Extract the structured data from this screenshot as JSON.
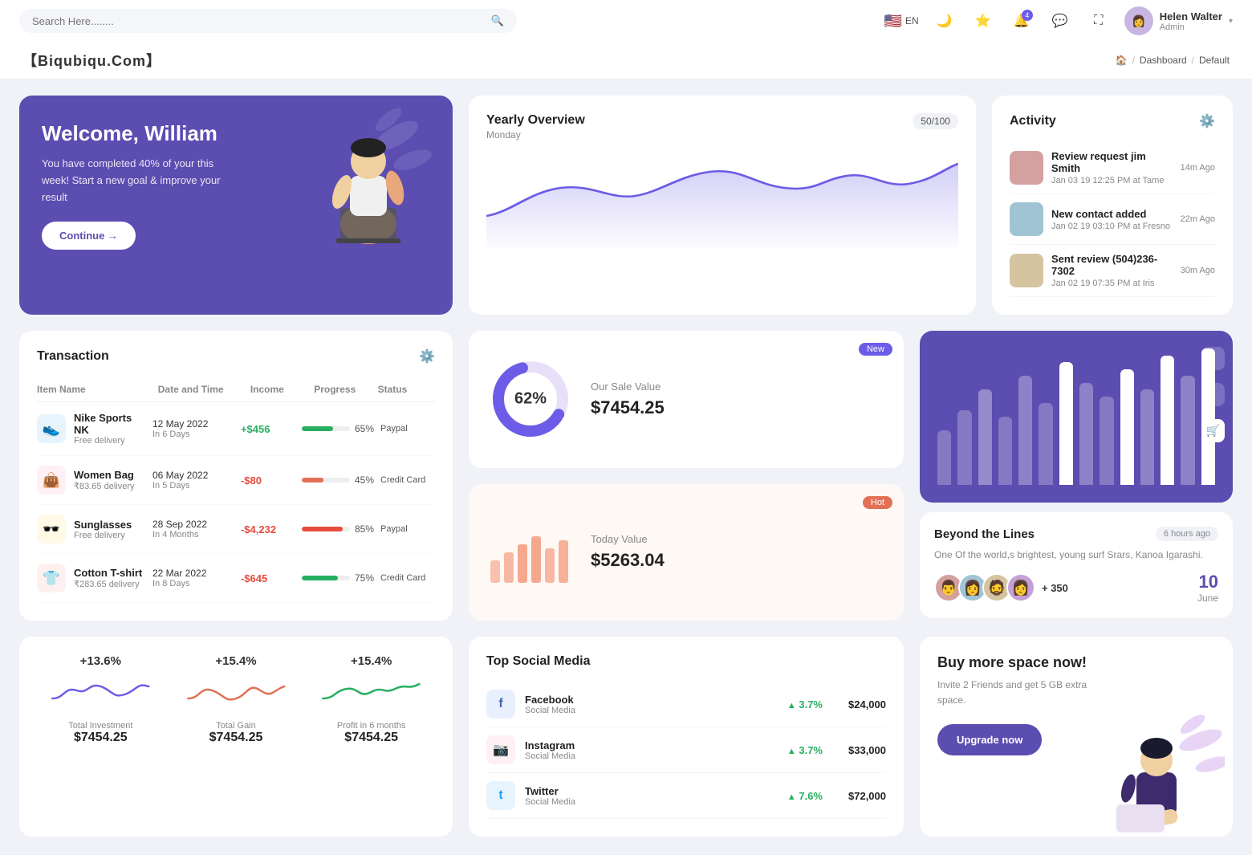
{
  "topnav": {
    "search_placeholder": "Search Here........",
    "lang": "EN",
    "user_name": "Helen Walter",
    "user_role": "Admin",
    "notification_count": "4"
  },
  "breadcrumb": {
    "brand": "【Biqubiqu.Com】",
    "home_icon": "🏠",
    "items": [
      "Dashboard",
      "Default"
    ]
  },
  "welcome": {
    "title": "Welcome, William",
    "description": "You have completed 40% of your this week! Start a new goal & improve your result",
    "button": "Continue →"
  },
  "yearly_overview": {
    "title": "Yearly Overview",
    "subtitle": "Monday",
    "badge": "50/100"
  },
  "activity": {
    "title": "Activity",
    "items": [
      {
        "title": "Review request jim Smith",
        "subtitle": "Jan 03 19 12:25 PM at Tame",
        "time": "14m Ago"
      },
      {
        "title": "New contact added",
        "subtitle": "Jan 02 19 03:10 PM at Fresno",
        "time": "22m Ago"
      },
      {
        "title": "Sent review (504)236-7302",
        "subtitle": "Jan 02 19 07:35 PM at Iris",
        "time": "30m Ago"
      }
    ]
  },
  "transaction": {
    "title": "Transaction",
    "columns": [
      "Item Name",
      "Date and Time",
      "Income",
      "Progress",
      "Status"
    ],
    "rows": [
      {
        "name": "Nike Sports NK",
        "sub": "Free delivery",
        "date": "12 May 2022",
        "days": "In 6 Days",
        "income": "+$456",
        "income_type": "pos",
        "progress": 65,
        "progress_color": "#27ae60",
        "status": "Paypal",
        "icon": "👟",
        "icon_bg": "#e8f4fd"
      },
      {
        "name": "Women Bag",
        "sub": "₹83.65 delivery",
        "date": "06 May 2022",
        "days": "In 5 Days",
        "income": "-$80",
        "income_type": "neg",
        "progress": 45,
        "progress_color": "#e17055",
        "status": "Credit Card",
        "icon": "👜",
        "icon_bg": "#fff0f5"
      },
      {
        "name": "Sunglasses",
        "sub": "Free delivery",
        "date": "28 Sep 2022",
        "days": "In 4 Months",
        "income": "-$4,232",
        "income_type": "neg",
        "progress": 85,
        "progress_color": "#e74c3c",
        "status": "Paypal",
        "icon": "🕶️",
        "icon_bg": "#fff9e6"
      },
      {
        "name": "Cotton T-shirt",
        "sub": "₹283.65 delivery",
        "date": "22 Mar 2022",
        "days": "In 8 Days",
        "income": "-$645",
        "income_type": "neg",
        "progress": 75,
        "progress_color": "#27ae60",
        "status": "Credit Card",
        "icon": "👕",
        "icon_bg": "#fff0f0"
      }
    ]
  },
  "sale_value": {
    "badge": "New",
    "percent": "62%",
    "label": "Our Sale Value",
    "value": "$7454.25"
  },
  "today_value": {
    "badge": "Hot",
    "label": "Today Value",
    "value": "$5263.04"
  },
  "beyond": {
    "title": "Beyond the Lines",
    "time": "6 hours ago",
    "description": "One Of the world,s brightest, young surf Srars, Kanoa Igarashi.",
    "plus_count": "+ 350",
    "date": "10",
    "month": "June"
  },
  "mini_charts": {
    "items": [
      {
        "pct": "+13.6%",
        "label": "Total Investment",
        "value": "$7454.25",
        "color": "#6c5ce7"
      },
      {
        "pct": "+15.4%",
        "label": "Total Gain",
        "value": "$7454.25",
        "color": "#e17055"
      },
      {
        "pct": "+15.4%",
        "label": "Profit in 6 months",
        "value": "$7454.25",
        "color": "#27ae60"
      }
    ]
  },
  "social_media": {
    "title": "Top Social Media",
    "items": [
      {
        "name": "Facebook",
        "sub": "Social Media",
        "pct": "3.7%",
        "amount": "$24,000",
        "icon": "f",
        "icon_bg": "#e8f0fe",
        "icon_color": "#4267B2"
      },
      {
        "name": "Instagram",
        "sub": "Social Media",
        "pct": "3.7%",
        "amount": "$33,000",
        "icon": "📷",
        "icon_bg": "#fff0f5",
        "icon_color": "#e1306c"
      },
      {
        "name": "Twitter",
        "sub": "Social Media",
        "pct": "7.6%",
        "amount": "$72,000",
        "icon": "t",
        "icon_bg": "#e8f4fd",
        "icon_color": "#1DA1F2"
      }
    ]
  },
  "buy_space": {
    "title": "Buy more space now!",
    "description": "Invite 2 Friends and get 5 GB extra space.",
    "button": "Upgrade now"
  }
}
